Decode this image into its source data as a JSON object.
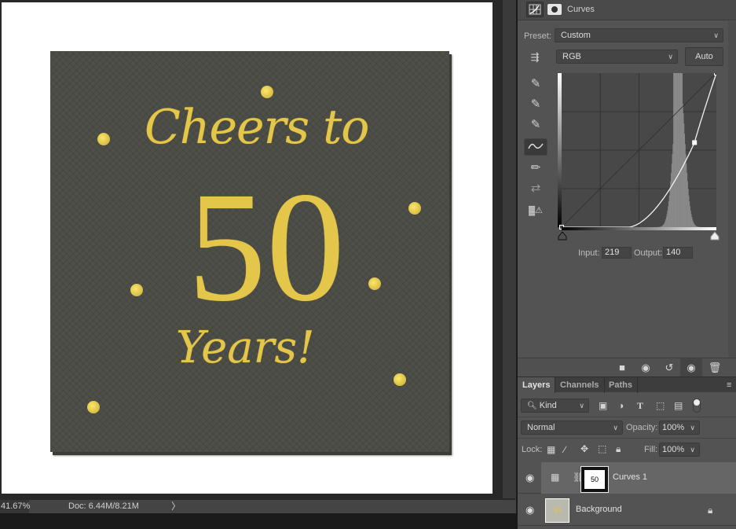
{
  "document": {
    "zoom_level": "41.67%",
    "doc_size": "Doc: 6.44M/8.21M",
    "status_arrow": "〉",
    "image": {
      "line1": "Cheers to",
      "line2": "50",
      "line3": "Years!"
    }
  },
  "properties": {
    "title": "Curves",
    "header_icons": [
      "curves-adjustment-icon",
      "mask-icon"
    ],
    "preset_label": "Preset:",
    "preset_value": "Custom",
    "channel_value": "RGB",
    "auto_label": "Auto",
    "tools": [
      "on-image-adjust-icon",
      "black-point-eyedropper-icon",
      "gray-point-eyedropper-icon",
      "white-point-eyedropper-icon",
      "edit-points-icon",
      "pencil-draw-icon",
      "smooth-icon",
      "clipping-warning-icon"
    ],
    "input_label": "Input:",
    "input_value": "219",
    "output_label": "Output:",
    "output_value": "140",
    "curve": {
      "points": [
        [
          0,
          0
        ],
        [
          219,
          140
        ],
        [
          255,
          255
        ]
      ],
      "selected_point": [
        219,
        140
      ]
    },
    "footer_icons": [
      "clip-to-layer-icon",
      "view-previous-state-icon",
      "reset-icon",
      "visibility-icon",
      "delete-icon"
    ]
  },
  "layers_panel": {
    "tabs": [
      {
        "label": "Layers",
        "active": true
      },
      {
        "label": "Channels",
        "active": false
      },
      {
        "label": "Paths",
        "active": false
      }
    ],
    "filter_label": "Kind",
    "filter_icons": [
      "pixel-filter-icon",
      "adjustment-filter-icon",
      "type-filter-icon",
      "shape-filter-icon",
      "smart-object-filter-icon"
    ],
    "blend_mode": "Normal",
    "opacity_label": "Opacity:",
    "opacity_value": "100%",
    "lock_label": "Lock:",
    "fill_label": "Fill:",
    "fill_value": "100%",
    "layers": [
      {
        "name": "Curves 1",
        "selected": true,
        "visible": true
      },
      {
        "name": "Background",
        "selected": false,
        "visible": true,
        "locked": true
      }
    ]
  },
  "colors": {
    "gold": "#e3c64a",
    "napkin": "#4e4f49",
    "panel": "#535353"
  }
}
